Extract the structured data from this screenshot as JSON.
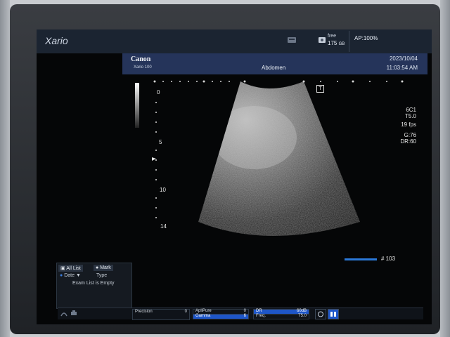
{
  "app": {
    "title": "Xario"
  },
  "topbar": {
    "storage_icon": "storage-device-icon",
    "disk_free_label": "free",
    "disk_free_value": "175",
    "disk_free_unit": "GB",
    "ap_label": "AP:100%"
  },
  "banner": {
    "brand": "Canon",
    "model": "Xario 100",
    "exam_type": "Abdomen",
    "date": "2023/10/04",
    "time": "11:03:54 AM"
  },
  "image": {
    "depth_marks": [
      "0",
      "5",
      "10",
      "14"
    ],
    "focus_marker": "T",
    "probe": "6C1",
    "transmit_freq": "T5.0",
    "frame_rate": "19 fps",
    "gain": "G:76",
    "dynamic_range": "DR:60",
    "frame_number": "# 103",
    "cine_progress": 0.95
  },
  "list_panel": {
    "tab_all": "All List",
    "tab_mark": "Mark",
    "col_date": "Date",
    "col_type": "Type",
    "empty_message": "Exam List is Empty"
  },
  "statusbar": {
    "precision_label": "Precision",
    "precision_value": "0",
    "applipure_label": "ApliPure",
    "applipure_value": "0",
    "gamma_label": "Gamma",
    "gamma_value": "6",
    "dr_label": "DR",
    "dr_value": "60dB",
    "freq_label": "Freq.",
    "freq_value": "T5.0"
  }
}
